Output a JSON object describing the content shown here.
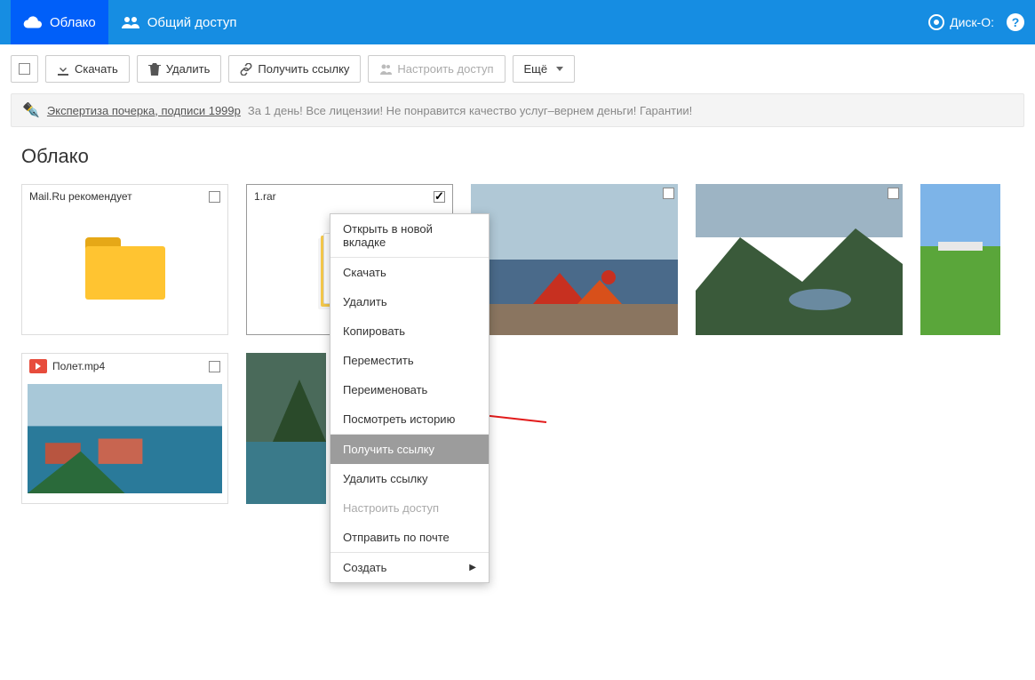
{
  "header": {
    "tab_cloud": "Облако",
    "tab_shared": "Общий доступ",
    "disko": "Диск-О:"
  },
  "toolbar": {
    "download": "Скачать",
    "delete": "Удалить",
    "get_link": "Получить ссылку",
    "access": "Настроить доступ",
    "more": "Ещё"
  },
  "promo": {
    "link": "Экспертиза почерка, подписи 1999р",
    "text": "За 1 день! Все лицензии! Не понравится качество услуг–вернем деньги! Гарантии!"
  },
  "section_title": "Облако",
  "cards": {
    "recommend": "Mail.Ru рекомендует",
    "rar": "1.rar",
    "video": "Полет.mp4"
  },
  "context_menu": {
    "open_tab": "Открыть в новой вкладке",
    "download": "Скачать",
    "delete": "Удалить",
    "copy": "Копировать",
    "move": "Переместить",
    "rename": "Переименовать",
    "history": "Посмотреть историю",
    "get_link": "Получить ссылку",
    "remove_link": "Удалить ссылку",
    "access": "Настроить доступ",
    "send_mail": "Отправить по почте",
    "create": "Создать"
  }
}
